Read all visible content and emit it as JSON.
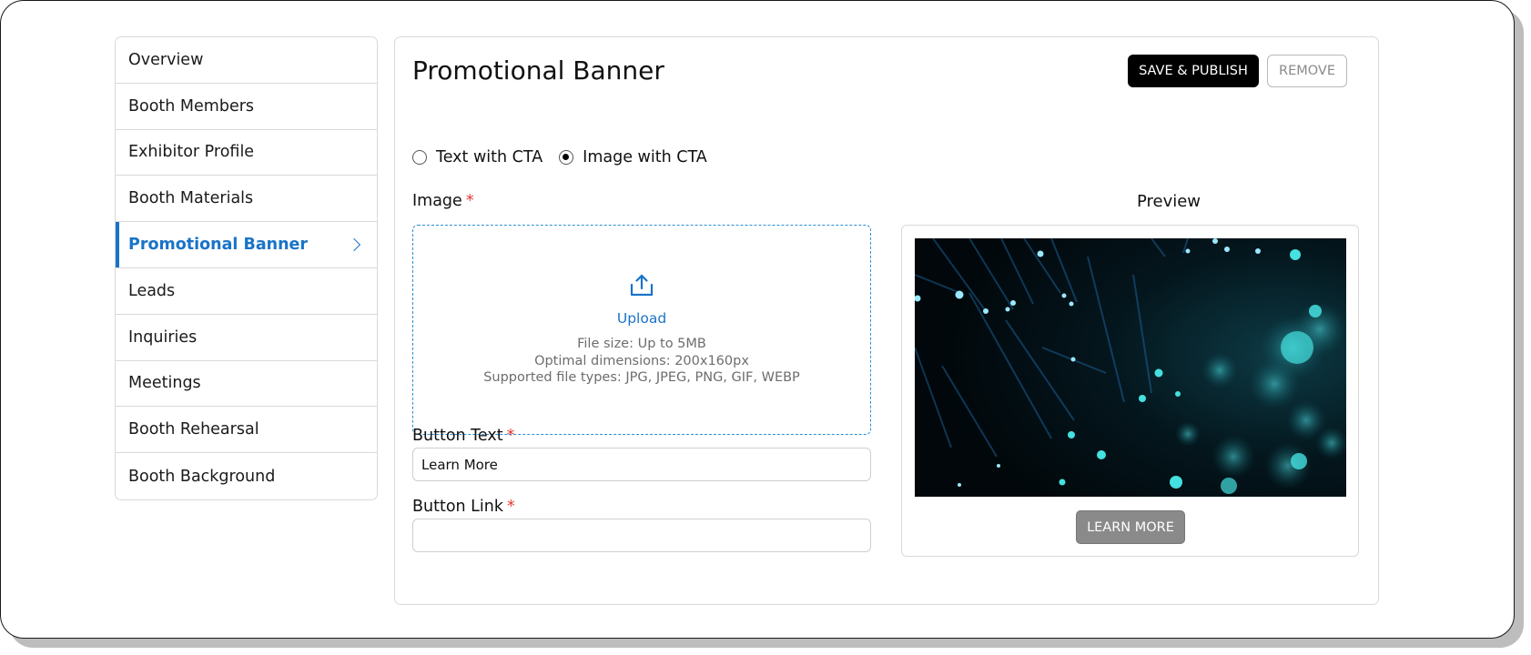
{
  "sidebar": {
    "items": [
      {
        "label": "Overview"
      },
      {
        "label": "Booth Members"
      },
      {
        "label": "Exhibitor Profile"
      },
      {
        "label": "Booth Materials"
      },
      {
        "label": "Promotional Banner",
        "active": true
      },
      {
        "label": "Leads"
      },
      {
        "label": "Inquiries"
      },
      {
        "label": "Meetings"
      },
      {
        "label": "Booth Rehearsal"
      },
      {
        "label": "Booth Background"
      }
    ]
  },
  "main": {
    "title": "Promotional Banner",
    "save_label": "SAVE & PUBLISH",
    "remove_label": "REMOVE",
    "radio_options": [
      {
        "label": "Text with CTA",
        "checked": false
      },
      {
        "label": "Image with CTA",
        "checked": true
      }
    ],
    "image_label": "Image",
    "required_mark": "*",
    "upload": {
      "label": "Upload",
      "file_size": "File size: Up to 5MB",
      "dimensions": "Optimal dimensions: 200x160px",
      "file_types": "Supported file types: JPG, JPEG, PNG, GIF, WEBP"
    },
    "button_text_label": "Button Text",
    "button_text_value": "Learn More",
    "button_link_label": "Button Link",
    "button_link_value": "",
    "preview": {
      "title": "Preview",
      "cta_label": "LEARN MORE"
    }
  },
  "colors": {
    "accent": "#1a73c8",
    "required": "#e53935",
    "primary_button": "#000000",
    "preview_button": "#8a8a8a"
  }
}
